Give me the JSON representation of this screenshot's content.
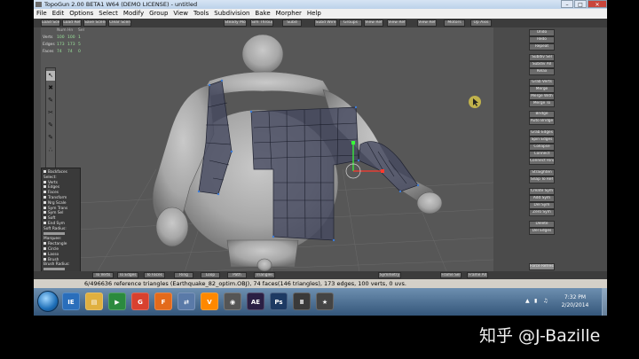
{
  "window": {
    "title": "TopoGun 2.00 BETA1 W64  (DEMO LICENSE) - untitled",
    "controls": [
      "–",
      "□",
      "✕"
    ]
  },
  "menu": [
    "File",
    "Edit",
    "Options",
    "Select",
    "Modify",
    "Group",
    "View",
    "Tools",
    "Subdivision",
    "Bake",
    "Morpher",
    "Help"
  ],
  "toolbar": {
    "left_buttons": [
      "Load Scene",
      "Load Ref",
      "Save Scene",
      "Clear Scene"
    ],
    "center_buttons": [
      "Steady Mode",
      "Sim Through"
    ],
    "right_buttons": [
      "Subd",
      "Subd Wire",
      "Groups",
      "View Ref",
      "View Ref",
      "View Ref",
      "Motors",
      "Up Axis"
    ]
  },
  "stats": {
    "header": [
      "Num",
      "Hn",
      "Sel"
    ],
    "rows": [
      {
        "label": "Verts",
        "num": "100",
        "hn": "100",
        "sel": "1"
      },
      {
        "label": "Edges",
        "num": "173",
        "hn": "173",
        "sel": "5"
      },
      {
        "label": "Faces",
        "num": "74",
        "hn": "74",
        "sel": "0"
      }
    ]
  },
  "tool_palette": [
    "↖",
    "✖",
    "✎",
    "✂",
    "✎",
    "✎",
    "∴"
  ],
  "left_panel": {
    "items": [
      {
        "kind": "check",
        "text": "Backfaces"
      },
      {
        "kind": "label",
        "text": "Select:"
      },
      {
        "kind": "check",
        "text": "Verts"
      },
      {
        "kind": "check",
        "text": "Edges"
      },
      {
        "kind": "check",
        "text": "Faces"
      },
      {
        "kind": "check",
        "text": "Transform"
      },
      {
        "kind": "check",
        "text": "Nrg Scale"
      },
      {
        "kind": "check",
        "text": "Sym Trans"
      },
      {
        "kind": "check",
        "text": "Sym Sel"
      },
      {
        "kind": "check",
        "text": "Soft"
      },
      {
        "kind": "check",
        "text": "End Sym"
      },
      {
        "kind": "label",
        "text": "Soft Radius:"
      },
      {
        "kind": "slider",
        "text": ""
      },
      {
        "kind": "label",
        "text": "Marquee:"
      },
      {
        "kind": "radio",
        "text": "Rectangle"
      },
      {
        "kind": "radio",
        "text": "Circle"
      },
      {
        "kind": "radio",
        "text": "Lasso"
      },
      {
        "kind": "radio",
        "text": "Brush"
      },
      {
        "kind": "label",
        "text": "Brush Radius:"
      },
      {
        "kind": "slider",
        "text": ""
      }
    ]
  },
  "right_panel": {
    "buttons": [
      "Undo",
      "Redo",
      "Repeat",
      "Subdiv Sel",
      "Subdiv All",
      "Relax",
      "Grab Verts",
      "Merge",
      "Merge With",
      "Merge To",
      "Bridge",
      "Auto Bridge",
      "Grab Edges",
      "Spin Edges",
      "Collapse",
      "Connect",
      "Connect Ring",
      "Straighten",
      "Snap To Ref",
      "Create Sym",
      "Add Sym",
      "Del Sym",
      "Zero Sym",
      "Delete",
      "Del Edges",
      "Force Refresh"
    ]
  },
  "bottom_bar": {
    "buttons": [
      "To Verts",
      "To Edges",
      "To Faces",
      "Ring",
      "Loop",
      "Path",
      "Triangles",
      "Symmetry",
      "Frame Sel",
      "Frame All"
    ]
  },
  "status": {
    "text": "6/496636 reference triangles (Earthquake_82_optim.OBJ), 74 faces(146 triangles), 173 edges, 100 verts, 0 uvs."
  },
  "taskbar": {
    "items": [
      "IE",
      "▤",
      "▶",
      "G",
      "F",
      "⇄",
      "V",
      "◉",
      "AE",
      "Ps",
      "Ⅱ",
      "★"
    ],
    "clock_time": "7:32 PM",
    "clock_date": "2/20/2014"
  },
  "watermark": "知乎 @J-Bazille",
  "colors": {
    "grid_line": "#3a3d52",
    "selected_face": "#474b60",
    "gizmo_red": "#ff3a2e",
    "gizmo_green": "#38ff38",
    "cursor": "#d4c24a"
  }
}
